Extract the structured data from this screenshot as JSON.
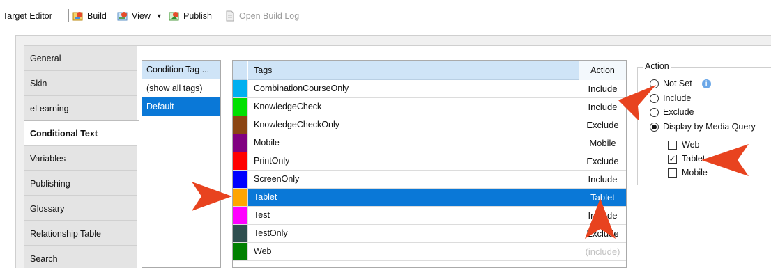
{
  "toolbar": {
    "title": "Target Editor",
    "build": "Build",
    "view": "View",
    "publish": "Publish",
    "open_build_log": "Open Build Log"
  },
  "sidebar": {
    "tabs": [
      {
        "label": "General",
        "active": false
      },
      {
        "label": "Skin",
        "active": false
      },
      {
        "label": "eLearning",
        "active": false
      },
      {
        "label": "Conditional Text",
        "active": true
      },
      {
        "label": "Variables",
        "active": false
      },
      {
        "label": "Publishing",
        "active": false
      },
      {
        "label": "Glossary",
        "active": false
      },
      {
        "label": "Relationship Table",
        "active": false
      },
      {
        "label": "Search",
        "active": false
      }
    ]
  },
  "condition_tag_sets": {
    "header": "Condition Tag ...",
    "items": [
      {
        "label": "(show all tags)",
        "selected": false
      },
      {
        "label": "Default",
        "selected": true
      }
    ]
  },
  "tags_grid": {
    "headers": {
      "tags": "Tags",
      "action": "Action"
    },
    "rows": [
      {
        "color": "#00b0f0",
        "name": "CombinationCourseOnly",
        "action": "Include",
        "selected": false,
        "dim": false
      },
      {
        "color": "#00e000",
        "name": "KnowledgeCheck",
        "action": "Include",
        "selected": false,
        "dim": false
      },
      {
        "color": "#8b4513",
        "name": "KnowledgeCheckOnly",
        "action": "Exclude",
        "selected": false,
        "dim": false
      },
      {
        "color": "#800080",
        "name": "Mobile",
        "action": "Mobile",
        "selected": false,
        "dim": false
      },
      {
        "color": "#ff0000",
        "name": "PrintOnly",
        "action": "Exclude",
        "selected": false,
        "dim": false
      },
      {
        "color": "#0000ff",
        "name": "ScreenOnly",
        "action": "Include",
        "selected": false,
        "dim": false
      },
      {
        "color": "#ffa500",
        "name": "Tablet",
        "action": "Tablet",
        "selected": true,
        "dim": false
      },
      {
        "color": "#ff00ff",
        "name": "Test",
        "action": "Include",
        "selected": false,
        "dim": false
      },
      {
        "color": "#2f4f4f",
        "name": "TestOnly",
        "action": "Exclude",
        "selected": false,
        "dim": false
      },
      {
        "color": "#008000",
        "name": "Web",
        "action": "(include)",
        "selected": false,
        "dim": true
      }
    ]
  },
  "action_panel": {
    "legend": "Action",
    "options": [
      {
        "label": "Not Set",
        "checked": false,
        "info": true
      },
      {
        "label": "Include",
        "checked": false,
        "info": false
      },
      {
        "label": "Exclude",
        "checked": false,
        "info": false
      },
      {
        "label": "Display by Media Query",
        "checked": true,
        "info": false
      }
    ],
    "media_queries": [
      {
        "label": "Web",
        "checked": false
      },
      {
        "label": "Tablet",
        "checked": true
      },
      {
        "label": "Mobile",
        "checked": false
      }
    ]
  },
  "colors": {
    "selection": "#0a78d7",
    "header_bg": "#cfe4f7",
    "callout": "#e8431f"
  }
}
